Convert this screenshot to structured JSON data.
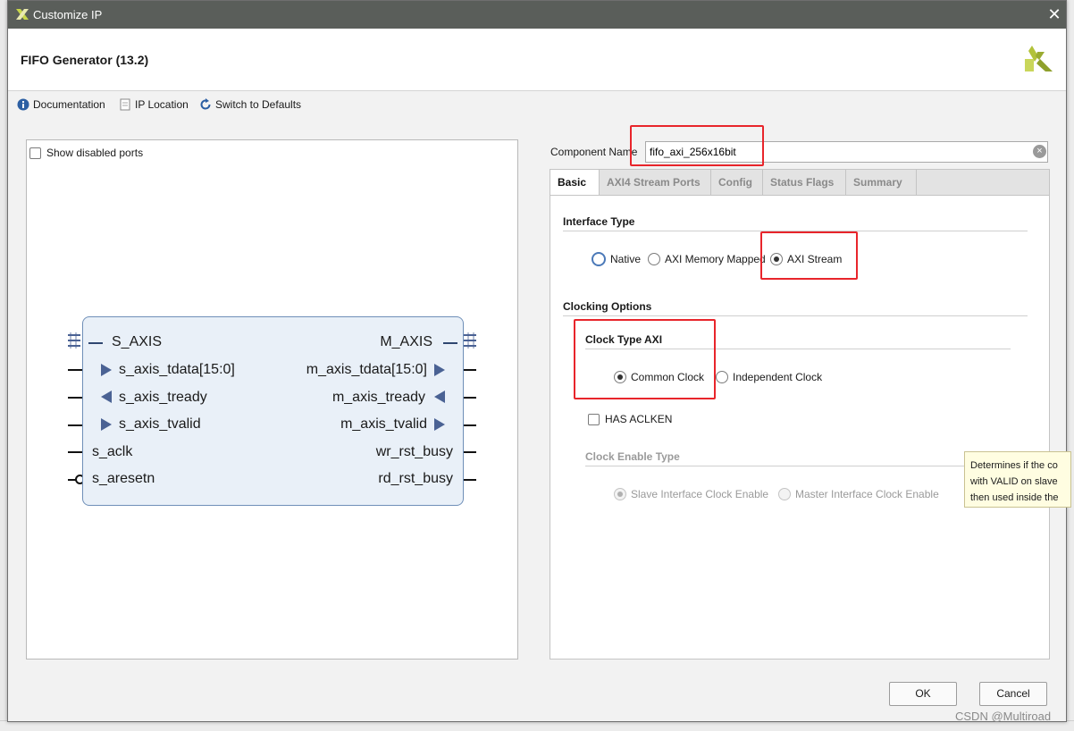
{
  "window": {
    "title": "Customize IP",
    "close_glyph": "✕"
  },
  "header": {
    "ip_title": "FIFO Generator (13.2)",
    "logo_icon": "xilinx-logo-icon"
  },
  "toolbar": {
    "documentation": "Documentation",
    "ip_location": "IP Location",
    "switch_defaults": "Switch to Defaults"
  },
  "left_pane": {
    "show_disabled_ports": "Show disabled ports",
    "symbol": {
      "left_bus": "S_AXIS",
      "right_bus": "M_AXIS",
      "left_ports": [
        "s_axis_tdata[15:0]",
        "s_axis_tready",
        "s_axis_tvalid",
        "s_aclk",
        "s_aresetn"
      ],
      "right_ports": [
        "m_axis_tdata[15:0]",
        "m_axis_tready",
        "m_axis_tvalid",
        "wr_rst_busy",
        "rd_rst_busy"
      ]
    }
  },
  "component": {
    "label": "Component Name",
    "value": "fifo_axi_256x16bit"
  },
  "tabs": [
    "Basic",
    "AXI4 Stream Ports",
    "Config",
    "Status Flags",
    "Summary"
  ],
  "basic": {
    "interface_type": {
      "heading": "Interface Type",
      "options": [
        "Native",
        "AXI Memory Mapped",
        "AXI Stream"
      ],
      "selected": "AXI Stream"
    },
    "clocking_options": {
      "heading": "Clocking Options",
      "clock_type": {
        "heading": "Clock Type AXI",
        "options": [
          "Common Clock",
          "Independent Clock"
        ],
        "selected": "Common Clock"
      },
      "has_aclken": "HAS ACLKEN",
      "clock_enable_type": {
        "heading": "Clock Enable Type",
        "options": [
          "Slave Interface Clock Enable",
          "Master Interface Clock Enable"
        ],
        "selected": "Slave Interface Clock Enable"
      }
    }
  },
  "tooltip": {
    "line1": "Determines if the co",
    "line2": "with VALID on slave",
    "line3": "then used inside the"
  },
  "buttons": {
    "ok": "OK",
    "cancel": "Cancel"
  },
  "watermark": "CSDN @Multiroad",
  "colors": {
    "titlebar": "#5a5e5a",
    "highlight": "#e8252b",
    "symbol_fill": "#e9f0f8",
    "port_arrow": "#4a6294"
  }
}
